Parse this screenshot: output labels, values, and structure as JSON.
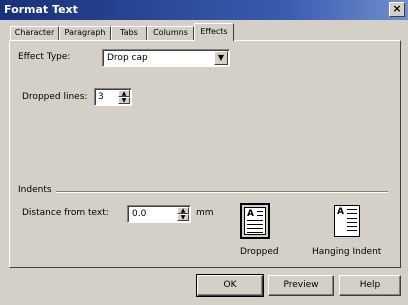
{
  "window": {
    "title": "Format Text",
    "close_glyph": "×"
  },
  "tabs": [
    {
      "label": "Character",
      "active": false
    },
    {
      "label": "Paragraph",
      "active": false
    },
    {
      "label": "Tabs",
      "active": false
    },
    {
      "label": "Columns",
      "active": false
    },
    {
      "label": "Effects",
      "active": true
    }
  ],
  "effects": {
    "effect_type_label": "Effect Type:",
    "effect_type_value": "Drop cap",
    "dropped_lines_label": "Dropped lines:",
    "dropped_lines_value": "3"
  },
  "indents": {
    "group_label": "Indents",
    "distance_label": "Distance from text:",
    "distance_value": "0.0",
    "unit": "mm",
    "options": [
      {
        "label": "Dropped",
        "selected": true
      },
      {
        "label": "Hanging Indent",
        "selected": false
      }
    ]
  },
  "buttons": {
    "ok": "OK",
    "preview": "Preview",
    "help": "Help"
  },
  "colors": {
    "face": "#d4d0c8",
    "title_start": "#17307a",
    "title_end": "#6f8fd0"
  }
}
